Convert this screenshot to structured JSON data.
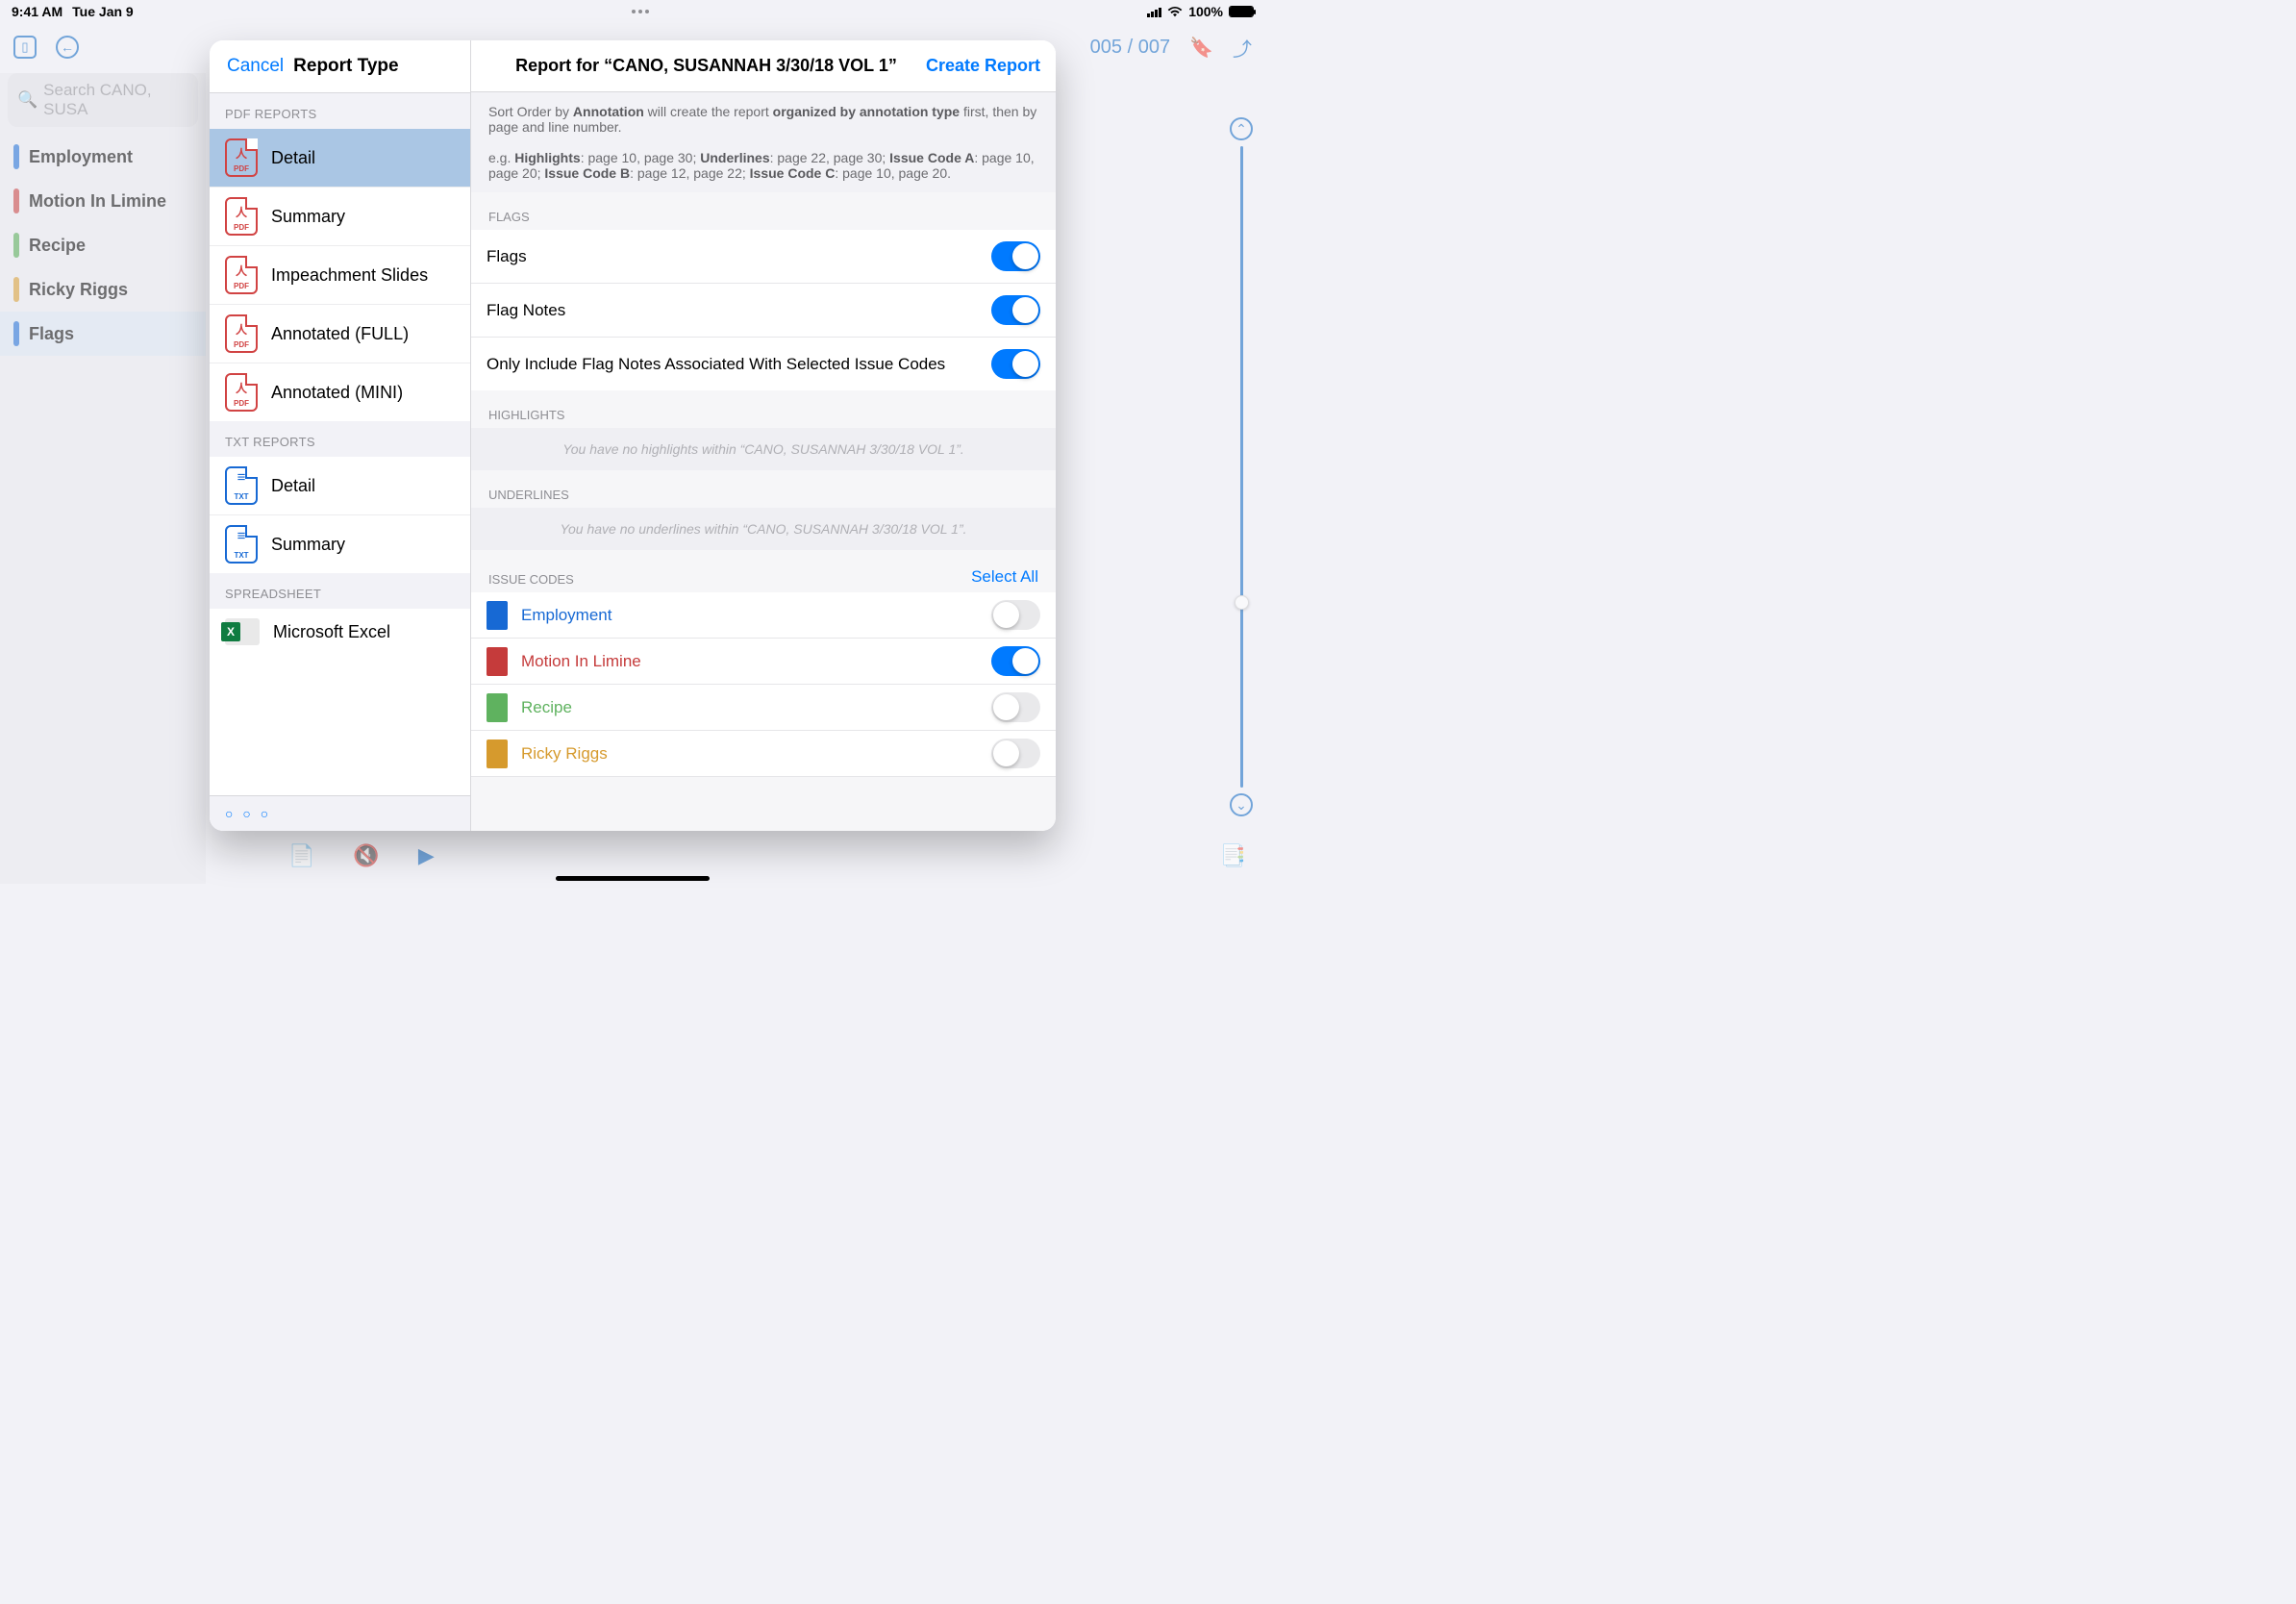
{
  "status": {
    "time": "9:41 AM",
    "date": "Tue Jan 9",
    "battery_pct": "100%"
  },
  "toolbar": {
    "page_indicator": "005 / 007"
  },
  "sidebar": {
    "search_placeholder": "Search CANO, SUSA",
    "tags": [
      {
        "label": "Employment",
        "color": "#1769d4",
        "selected": false
      },
      {
        "label": "Motion In Limine",
        "color": "#c53b3b",
        "selected": false
      },
      {
        "label": "Recipe",
        "color": "#4fa84f",
        "selected": false
      },
      {
        "label": "Ricky Riggs",
        "color": "#d69a2d",
        "selected": false
      },
      {
        "label": "Flags",
        "color": "#1769d4",
        "selected": true
      }
    ]
  },
  "modal": {
    "cancel": "Cancel",
    "title": "Report Type",
    "header": "Report for “CANO, SUSANNAH 3/30/18 VOL 1”",
    "create": "Create Report",
    "sections": {
      "pdf_header": "PDF REPORTS",
      "txt_header": "TXT REPORTS",
      "sheet_header": "SPREADSHEET"
    },
    "pdf_reports": [
      "Detail",
      "Summary",
      "Impeachment Slides",
      "Annotated (FULL)",
      "Annotated (MINI)"
    ],
    "txt_reports": [
      "Detail",
      "Summary"
    ],
    "spreadsheet": [
      "Microsoft Excel"
    ],
    "description": {
      "line1a": "Sort Order by ",
      "line1b": "Annotation",
      "line1c": " will create the report ",
      "line1d": "organized by annotation type",
      "line1e": " first, then by page and line number.",
      "line2a": "e.g. ",
      "h": "Highlights",
      "h_v": ": page 10, page 30; ",
      "u": "Underlines",
      "u_v": ": page 22, page 30; ",
      "ia": "Issue Code A",
      "ia_v": ": page 10, page 20; ",
      "ib": "Issue Code B",
      "ib_v": ": page 12, page 22; ",
      "ic": "Issue Code C",
      "ic_v": ": page 10, page 20."
    },
    "flags": {
      "header": "FLAGS",
      "rows": [
        {
          "label": "Flags",
          "on": true
        },
        {
          "label": "Flag Notes",
          "on": true
        },
        {
          "label": "Only Include Flag Notes Associated With Selected Issue Codes",
          "on": true
        }
      ]
    },
    "highlights": {
      "header": "HIGHLIGHTS",
      "empty": "You have no highlights within “CANO, SUSANNAH 3/30/18 VOL 1”."
    },
    "underlines": {
      "header": "UNDERLINES",
      "empty": "You have no underlines within “CANO, SUSANNAH 3/30/18 VOL 1”."
    },
    "issue_codes": {
      "header": "ISSUE CODES",
      "select_all": "Select All",
      "items": [
        {
          "label": "Employment",
          "color": "#1769d4",
          "on": false
        },
        {
          "label": "Motion In Limine",
          "color": "#c53b3b",
          "on": true
        },
        {
          "label": "Recipe",
          "color": "#5fb25f",
          "on": false
        },
        {
          "label": "Ricky Riggs",
          "color": "#d69a2d",
          "on": false
        }
      ]
    }
  }
}
